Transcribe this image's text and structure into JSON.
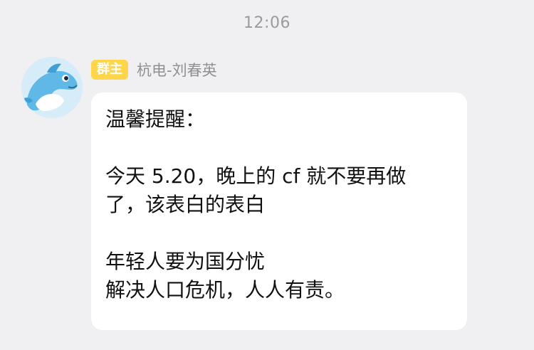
{
  "chat": {
    "timestamp": "12:06",
    "message": {
      "sender": {
        "role_badge": "群主",
        "name": "杭电-刘春英",
        "avatar_icon": "dolphin-avatar-icon"
      },
      "lines": [
        "温馨提醒：",
        "",
        "今天 5.20，晚上的 cf 就不要再做",
        "了，该表白的表白",
        "",
        "年轻人要为国分忧",
        "解决人口危机，人人有责。"
      ]
    }
  },
  "colors": {
    "background": "#f0f0f3",
    "badge": "#ffd54a",
    "bubble": "#ffffff",
    "timestamp": "#9a9a9f",
    "sender_name": "#8f8f94"
  }
}
